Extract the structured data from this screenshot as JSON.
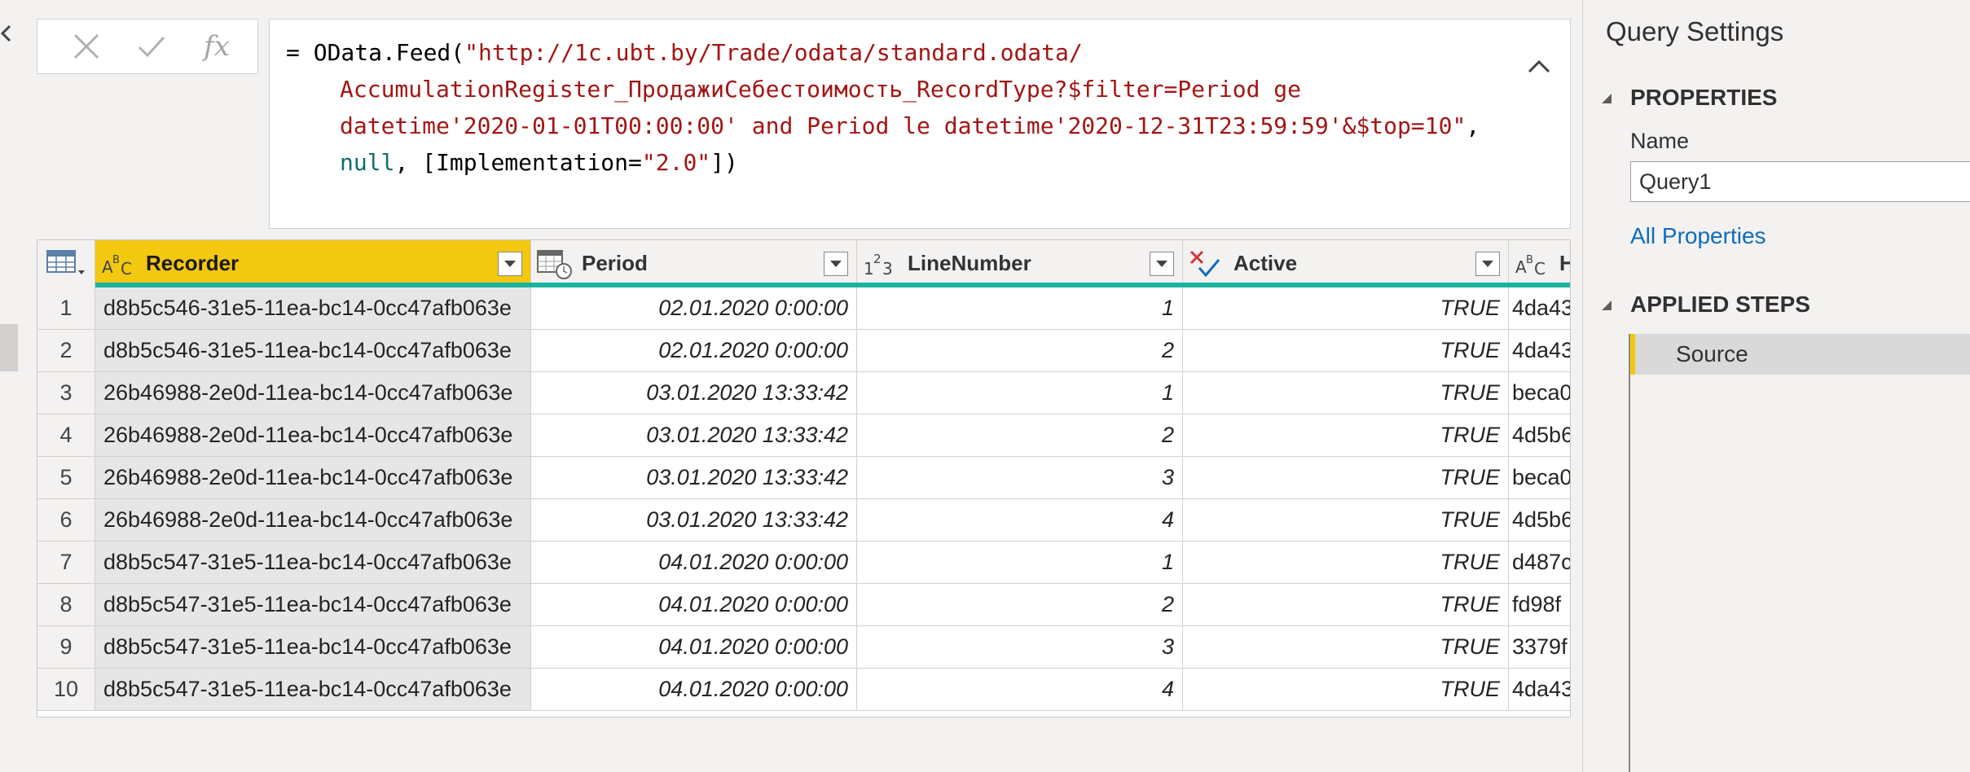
{
  "formula_bar": {
    "fx_label": "fx",
    "line1_prefix": "= OData.Feed(",
    "line1_str": "\"http://1c.ubt.by/Trade/odata/standard.odata/",
    "line2_str": "AccumulationRegister_ПродажиСебестоимость_RecordType?$filter=Period ge",
    "line3_str": "datetime'2020-01-01T00:00:00' and Period le datetime'2020-12-31T23:59:59'&$top=10\"",
    "line3_suffix": ",",
    "line4_kw": "null",
    "line4_mid": ", [Implementation=",
    "line4_str": "\"2.0\"",
    "line4_end": "])"
  },
  "grid": {
    "columns": [
      {
        "name": "Recorder",
        "type": "text"
      },
      {
        "name": "Period",
        "type": "datetime"
      },
      {
        "name": "LineNumber",
        "type": "number"
      },
      {
        "name": "Active",
        "type": "logical"
      },
      {
        "name": "H",
        "type": "text"
      }
    ],
    "rows": [
      {
        "n": "1",
        "recorder": "d8b5c546-31e5-11ea-bc14-0cc47afb063e",
        "period": "02.01.2020 0:00:00",
        "line": "1",
        "active": "TRUE",
        "h": "4da43"
      },
      {
        "n": "2",
        "recorder": "d8b5c546-31e5-11ea-bc14-0cc47afb063e",
        "period": "02.01.2020 0:00:00",
        "line": "2",
        "active": "TRUE",
        "h": "4da43"
      },
      {
        "n": "3",
        "recorder": "26b46988-2e0d-11ea-bc14-0cc47afb063e",
        "period": "03.01.2020 13:33:42",
        "line": "1",
        "active": "TRUE",
        "h": "beca0"
      },
      {
        "n": "4",
        "recorder": "26b46988-2e0d-11ea-bc14-0cc47afb063e",
        "period": "03.01.2020 13:33:42",
        "line": "2",
        "active": "TRUE",
        "h": "4d5b6"
      },
      {
        "n": "5",
        "recorder": "26b46988-2e0d-11ea-bc14-0cc47afb063e",
        "period": "03.01.2020 13:33:42",
        "line": "3",
        "active": "TRUE",
        "h": "beca0"
      },
      {
        "n": "6",
        "recorder": "26b46988-2e0d-11ea-bc14-0cc47afb063e",
        "period": "03.01.2020 13:33:42",
        "line": "4",
        "active": "TRUE",
        "h": "4d5b6"
      },
      {
        "n": "7",
        "recorder": "d8b5c547-31e5-11ea-bc14-0cc47afb063e",
        "period": "04.01.2020 0:00:00",
        "line": "1",
        "active": "TRUE",
        "h": "d487c"
      },
      {
        "n": "8",
        "recorder": "d8b5c547-31e5-11ea-bc14-0cc47afb063e",
        "period": "04.01.2020 0:00:00",
        "line": "2",
        "active": "TRUE",
        "h": "fd98f"
      },
      {
        "n": "9",
        "recorder": "d8b5c547-31e5-11ea-bc14-0cc47afb063e",
        "period": "04.01.2020 0:00:00",
        "line": "3",
        "active": "TRUE",
        "h": "3379f"
      },
      {
        "n": "10",
        "recorder": "d8b5c547-31e5-11ea-bc14-0cc47afb063e",
        "period": "04.01.2020 0:00:00",
        "line": "4",
        "active": "TRUE",
        "h": "4da43"
      }
    ]
  },
  "query_settings": {
    "title": "Query Settings",
    "properties_title": "PROPERTIES",
    "name_label": "Name",
    "name_value": "Query1",
    "all_properties_link": "All Properties",
    "applied_steps_title": "APPLIED STEPS",
    "steps": [
      "Source"
    ]
  },
  "colors": {
    "selected_header": "#f2c811",
    "quality_bar": "#1ab39f",
    "string_literal": "#a31515",
    "keyword": "#0f6e6e",
    "link": "#0f6cbd"
  },
  "icons": {
    "cancel": "close-icon",
    "commit": "check-icon",
    "text_type": "abc-type-icon",
    "datetime_type": "calendar-clock-icon",
    "number_type": "123-type-icon",
    "logical_type": "logical-check-icon",
    "dropdown": "chevron-down-icon",
    "collapse": "chevron-up-icon",
    "table": "table-icon"
  }
}
